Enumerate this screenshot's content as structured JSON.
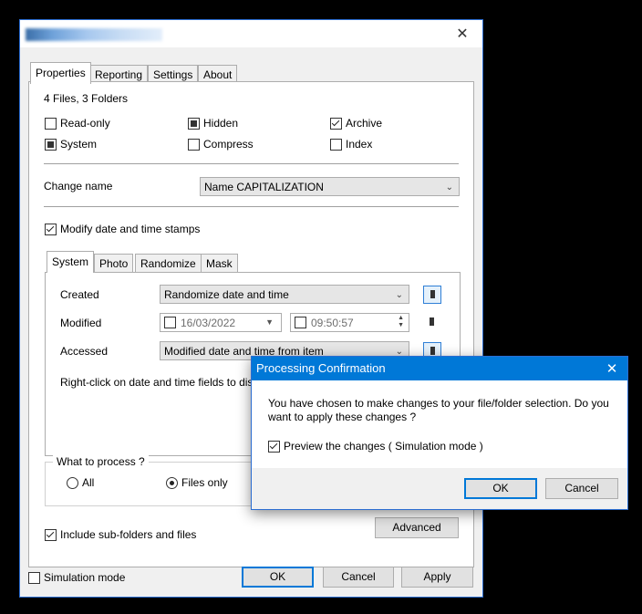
{
  "main": {
    "title_blurred": "",
    "tabs": [
      "Properties",
      "Reporting",
      "Settings",
      "About"
    ],
    "summary": "4 Files, 3 Folders",
    "attributes": {
      "read_only": "Read-only",
      "hidden": "Hidden",
      "archive": "Archive",
      "system": "System",
      "compress": "Compress",
      "index": "Index"
    },
    "change_name_label": "Change name",
    "change_name_value": "Name CAPITALIZATION",
    "modify_dates_label": "Modify date and time stamps",
    "subtabs": [
      "System",
      "Photo",
      "Randomize",
      "Mask"
    ],
    "created_label": "Created",
    "created_value": "Randomize date and time",
    "modified_label": "Modified",
    "modified_date": "16/03/2022",
    "modified_time": "09:50:57",
    "accessed_label": "Accessed",
    "accessed_value": "Modified date and time from item",
    "hint_text": "Right-click on date and time fields to disp",
    "what_to_process_label": "What to process ?",
    "radio_all": "All",
    "radio_files_only": "Files only",
    "include_subfolders_label": "Include sub-folders and files",
    "advanced_button": "Advanced",
    "simulation_mode_label": "Simulation mode",
    "ok_button": "OK",
    "cancel_button": "Cancel",
    "apply_button": "Apply"
  },
  "dialog": {
    "title": "Processing Confirmation",
    "message_line1": "You have chosen to make changes to your file/folder selection.  Do you",
    "message_line2": "want to apply these changes ?",
    "preview_label": "Preview the changes ( Simulation mode )",
    "ok_button": "OK",
    "cancel_button": "Cancel"
  },
  "icons": {
    "close": "close-icon",
    "chevron": "chevron-down-icon"
  },
  "colors": {
    "accent": "#0078d7",
    "window_border": "#2b6dd1",
    "panel_bg": "#f0f0f0"
  }
}
